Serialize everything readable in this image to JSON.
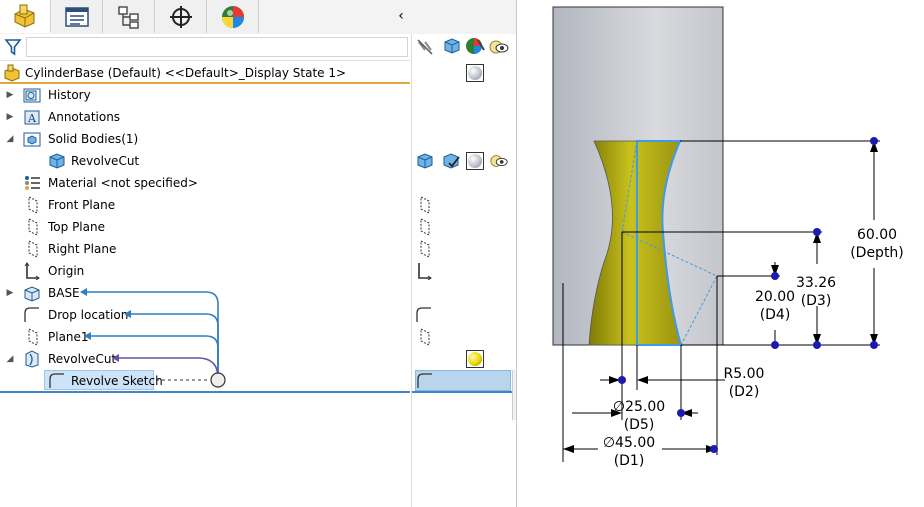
{
  "tree": {
    "root_label": "CylinderBase (Default) <<Default>_Display State 1>",
    "collapse_glyph": "‹",
    "filter_placeholder": "",
    "items": [
      {
        "label": "History",
        "icon": "history-icon"
      },
      {
        "label": "Annotations",
        "icon": "annotations-icon"
      },
      {
        "label": "Solid Bodies(1)",
        "icon": "solid-bodies-folder-icon"
      },
      {
        "label": "RevolveCut",
        "icon": "solid-body-icon"
      },
      {
        "label": "Material <not specified>",
        "icon": "material-icon"
      },
      {
        "label": "Front Plane",
        "icon": "plane-icon"
      },
      {
        "label": "Top Plane",
        "icon": "plane-icon"
      },
      {
        "label": "Right Plane",
        "icon": "plane-icon"
      },
      {
        "label": "Origin",
        "icon": "origin-icon"
      },
      {
        "label": "BASE",
        "icon": "extrude-feature-icon"
      },
      {
        "label": "Drop location",
        "icon": "sketch-icon"
      },
      {
        "label": "Plane1",
        "icon": "plane-icon"
      },
      {
        "label": "RevolveCut",
        "icon": "revolve-cut-icon"
      },
      {
        "label": "Revolve Sketch",
        "icon": "sketch-icon"
      }
    ]
  },
  "tabs": [
    "featuremanager-icon",
    "propertymanager-icon",
    "configurationmanager-icon",
    "dimxpert-icon",
    "displaymanager-icon"
  ],
  "columns": [
    "hide-show-icon",
    "solid-body-icon",
    "appearance-icon",
    "display-state-icon"
  ],
  "colors": {
    "accent_orange": "#e2a63a",
    "accent_blue": "#3d87c7",
    "link_arrow_blue": "#2f7fc1",
    "link_arrow_purple": "#6a4fa6",
    "part_yellow": "#b8b21c",
    "dimension_point": "#1b1bb0"
  },
  "drawing": {
    "dimensions": [
      {
        "value": "60.00",
        "name": "(Depth)"
      },
      {
        "value": "33.26",
        "name": "(D3)"
      },
      {
        "value": "20.00",
        "name": "(D4)"
      },
      {
        "value": "R5.00",
        "name": "(D2)"
      },
      {
        "value": "∅25.00",
        "name": "(D5)"
      },
      {
        "value": "∅45.00",
        "name": "(D1)"
      }
    ]
  }
}
